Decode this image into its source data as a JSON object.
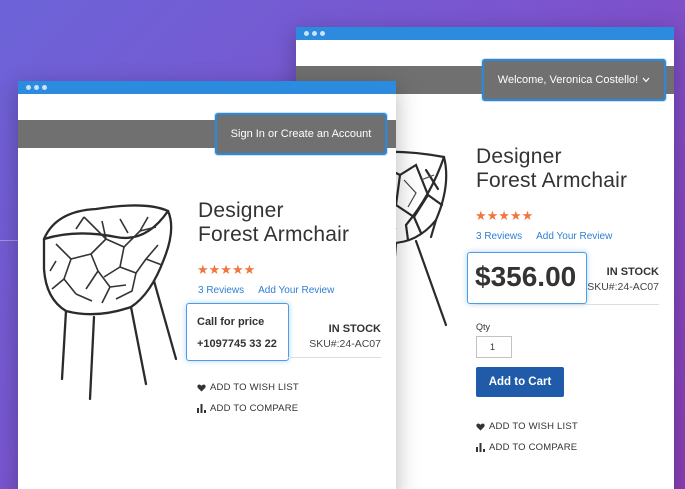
{
  "back_window": {
    "welcome_label": "Welcome, Veronica Costello!",
    "product_title_line1": "Designer",
    "product_title_line2": "Forest Armchair",
    "stars": "★★★★★",
    "reviews_link": "3 Reviews",
    "add_review_link": "Add Your Review",
    "price": "$356.00",
    "stock_status": "IN STOCK",
    "sku": "SKU#:24-AC07",
    "qty_label": "Qty",
    "qty_value": "1",
    "add_to_cart_label": "Add to Cart",
    "wish_list_label": "ADD TO WISH LIST",
    "compare_label": "ADD TO COMPARE"
  },
  "front_window": {
    "signin_label": "Sign In or Create an Account",
    "product_title_line1": "Designer",
    "product_title_line2": "Forest Armchair",
    "stars": "★★★★★",
    "reviews_link": "3 Reviews",
    "add_review_link": "Add Your Review",
    "call_label": "Call for price",
    "phone": "+1097745 33 22",
    "stock_status": "IN STOCK",
    "sku": "SKU#:24-AC07",
    "wish_list_label": "ADD TO WISH LIST",
    "compare_label": "ADD TO COMPARE"
  },
  "colors": {
    "accent": "#2c8bdf",
    "header_gray": "#707070",
    "star": "#f0763f",
    "link": "#2f7fd1",
    "cart_button": "#1f5ba9"
  },
  "icons": [
    "heart-icon",
    "bar-chart-icon",
    "chevron-down-icon"
  ]
}
